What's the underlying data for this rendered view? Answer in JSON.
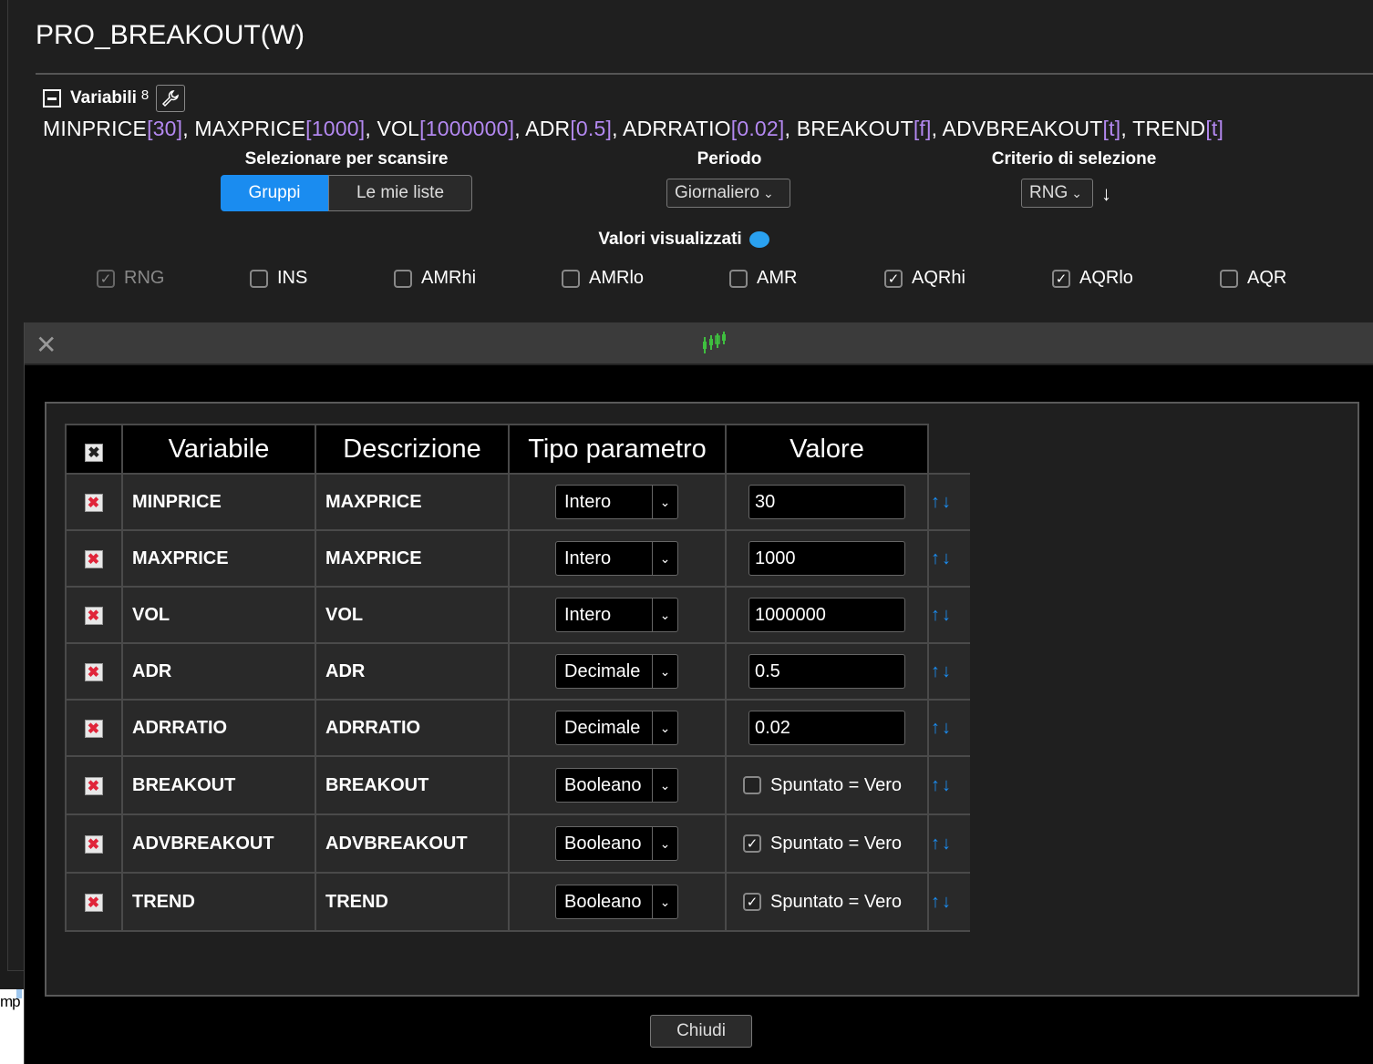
{
  "title": "PRO_BREAKOUT(W)",
  "variables": {
    "label": "Variabili",
    "count": "8",
    "line": [
      {
        "name": "MINPRICE",
        "value": "[30]",
        "sep": ", "
      },
      {
        "name": "MAXPRICE",
        "value": "[1000]",
        "sep": ", "
      },
      {
        "name": "VOL",
        "value": "[1000000]",
        "sep": ", "
      },
      {
        "name": "ADR",
        "value": "[0.5]",
        "sep": ", "
      },
      {
        "name": "ADRRATIO",
        "value": "[0.02]",
        "sep": ", "
      },
      {
        "name": "BREAKOUT",
        "value": "[f]",
        "sep": ", "
      },
      {
        "name": "ADVBREAKOUT",
        "value": "[t]",
        "sep": ", "
      },
      {
        "name": "TREND",
        "value": "[t]",
        "sep": ""
      }
    ]
  },
  "scan": {
    "label": "Selezionare per scansire",
    "options": [
      "Gruppi",
      "Le mie liste"
    ],
    "selected": "Gruppi"
  },
  "periodo": {
    "label": "Periodo",
    "value": "Giornaliero"
  },
  "criterio": {
    "label": "Criterio di selezione",
    "value": "RNG"
  },
  "valori": {
    "label": "Valori visualizzati",
    "items": [
      {
        "label": "RNG",
        "checked": true,
        "disabled": true
      },
      {
        "label": "INS",
        "checked": false
      },
      {
        "label": "AMRhi",
        "checked": false
      },
      {
        "label": "AMRlo",
        "checked": false
      },
      {
        "label": "AMR",
        "checked": false
      },
      {
        "label": "AQRhi",
        "checked": true
      },
      {
        "label": "AQRlo",
        "checked": true
      },
      {
        "label": "AQR",
        "checked": false
      }
    ]
  },
  "table": {
    "headers": [
      "Variabile",
      "Descrizione",
      "Tipo parametro",
      "Valore"
    ],
    "rows": [
      {
        "variable": "MINPRICE",
        "description": "MAXPRICE",
        "type": "Intero",
        "value": "30"
      },
      {
        "variable": "MAXPRICE",
        "description": "MAXPRICE",
        "type": "Intero",
        "value": "1000"
      },
      {
        "variable": "VOL",
        "description": "VOL",
        "type": "Intero",
        "value": "1000000"
      },
      {
        "variable": "ADR",
        "description": "ADR",
        "type": "Decimale",
        "value": "0.5"
      },
      {
        "variable": "ADRRATIO",
        "description": "ADRRATIO",
        "type": "Decimale",
        "value": "0.02"
      },
      {
        "variable": "BREAKOUT",
        "description": "BREAKOUT",
        "type": "Booleano",
        "checked": false,
        "bool_label": "Spuntato = Vero"
      },
      {
        "variable": "ADVBREAKOUT",
        "description": "ADVBREAKOUT",
        "type": "Booleano",
        "checked": true,
        "bool_label": "Spuntato = Vero"
      },
      {
        "variable": "TREND",
        "description": "TREND",
        "type": "Booleano",
        "checked": true,
        "bool_label": "Spuntato = Vero"
      }
    ]
  },
  "close_button": "Chiudi",
  "left_fragment": "mp",
  "colors": {
    "accent": "#1a8cf0",
    "param_value": "#b388f0",
    "delete_x": "#e0253a"
  }
}
